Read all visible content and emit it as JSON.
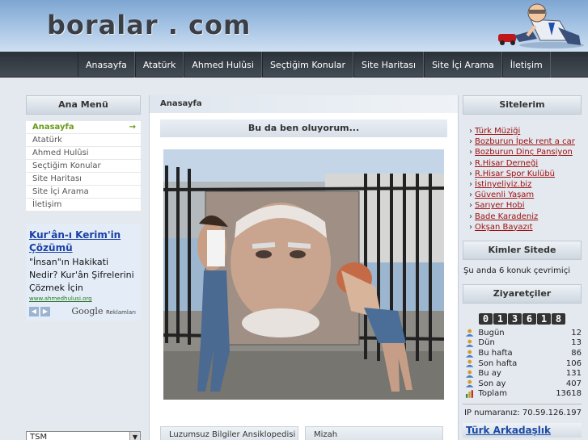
{
  "site": {
    "logo_text": "boralar . com"
  },
  "nav": [
    "Anasayfa",
    "Atatürk",
    "Ahmed Hulûsi",
    "Seçtiğim Konular",
    "Site Haritası",
    "Site İçi Arama",
    "İletişim"
  ],
  "left": {
    "menu_title": "Ana Menü",
    "menu_items": [
      {
        "label": "Anasayfa",
        "active": true,
        "arrow": "→"
      },
      {
        "label": "Atatürk"
      },
      {
        "label": "Ahmed Hulûsi"
      },
      {
        "label": "Seçtiğim Konular"
      },
      {
        "label": "Site Haritası"
      },
      {
        "label": "Site İçi Arama"
      },
      {
        "label": "İletişim"
      }
    ],
    "ad": {
      "title": "Kur'ân-ı Kerim'in Çözümü",
      "text": "\"İnsan\"ın Hakikati Nedir? Kur'ân Şifrelerini Çözmek İçin",
      "url": "www.ahmedhulusi.org",
      "prev": "◀",
      "next": "▶",
      "brand": "Google",
      "brand_suffix": "Reklamları"
    },
    "select_value": "TSM",
    "select_arrow": "▼"
  },
  "center": {
    "breadcrumb": "Anasayfa",
    "article_title": "Bu da ben oluyorum...",
    "bottom_boxes": [
      "Luzumsuz Bilgiler Ansiklopedisi",
      "Mizah"
    ]
  },
  "right": {
    "sites_title": "Sitelerim",
    "sites": [
      "Türk Müziği",
      "Bozburun İpek rent a car",
      "Bozburun Dinç Pansiyon",
      "R.Hisar Derneği",
      "R.Hisar Spor Kulübü",
      "İstinyeliyiz.biz",
      "Güvenli Yaşam",
      "Sarıyer Hobi",
      "Bade Karadeniz",
      "Okşan Bayazıt"
    ],
    "who_title": "Kimler Sitede",
    "who_text": "Şu anda 6 konuk çevrimiçi",
    "visitors_title": "Ziyaretçiler",
    "counter": "013618",
    "stats": [
      {
        "label": "Bugün",
        "value": "12",
        "icon": "user-icon"
      },
      {
        "label": "Dün",
        "value": "13",
        "icon": "user-icon"
      },
      {
        "label": "Bu hafta",
        "value": "86",
        "icon": "user-icon"
      },
      {
        "label": "Son hafta",
        "value": "106",
        "icon": "user-icon"
      },
      {
        "label": "Bu ay",
        "value": "131",
        "icon": "user-icon"
      },
      {
        "label": "Son ay",
        "value": "407",
        "icon": "user-icon"
      },
      {
        "label": "Toplam",
        "value": "13618",
        "icon": "bar-chart-icon"
      }
    ],
    "ip_text": "IP numaranız: 70.59.126.197",
    "friend_link": "Türk Arkadaşlık Sitesi"
  },
  "colors": {
    "nav_bg": "#343b43",
    "active": "#6a9a1a",
    "link": "#a01010"
  }
}
